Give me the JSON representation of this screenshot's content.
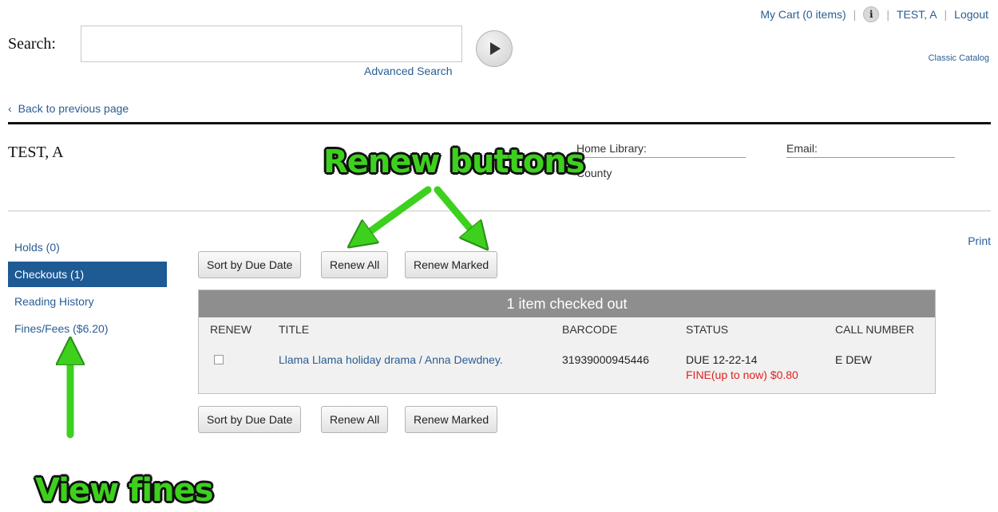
{
  "top_nav": {
    "cart": "My Cart (0 items)",
    "separator": "|",
    "info_glyph": "i",
    "user": "TEST, A",
    "logout": "Logout",
    "classic_catalog": "Classic Catalog"
  },
  "search": {
    "label": "Search:",
    "value": "",
    "placeholder": "",
    "advanced_link": "Advanced Search",
    "go_icon": "play-arrow-icon"
  },
  "back_link": "Back to previous page",
  "back_glyph": "‹",
  "patron": {
    "name": "TEST, A",
    "home_library_label": "Home Library:",
    "home_library_value": "County",
    "email_label": "Email:"
  },
  "sidebar": {
    "items": [
      {
        "label": "Holds (0)",
        "active": false
      },
      {
        "label": "Checkouts (1)",
        "active": true
      },
      {
        "label": "Reading History",
        "active": false
      },
      {
        "label": "Fines/Fees ($6.20)",
        "active": false
      }
    ]
  },
  "print_link": "Print",
  "toolbar": {
    "sort": "Sort by Due Date",
    "renew_all": "Renew All",
    "renew_marked": "Renew Marked"
  },
  "checkouts": {
    "heading": "1 item checked out",
    "columns": [
      "RENEW",
      "TITLE",
      "BARCODE",
      "STATUS",
      "CALL NUMBER"
    ],
    "rows": [
      {
        "checked": false,
        "title": "Llama Llama holiday drama / Anna Dewdney.",
        "barcode": "31939000945446",
        "status": "DUE 12-22-14",
        "fine": "FINE(up to now) $0.80",
        "call_number": "E DEW"
      }
    ]
  },
  "annotations": {
    "renew_callout": "Renew buttons",
    "fines_callout": "View fines",
    "color": "#3dd11d"
  },
  "colors": {
    "accent": "#1e5a94",
    "link": "#2a5d95",
    "fine": "#e02020",
    "table_header": "#8e8e8e"
  }
}
